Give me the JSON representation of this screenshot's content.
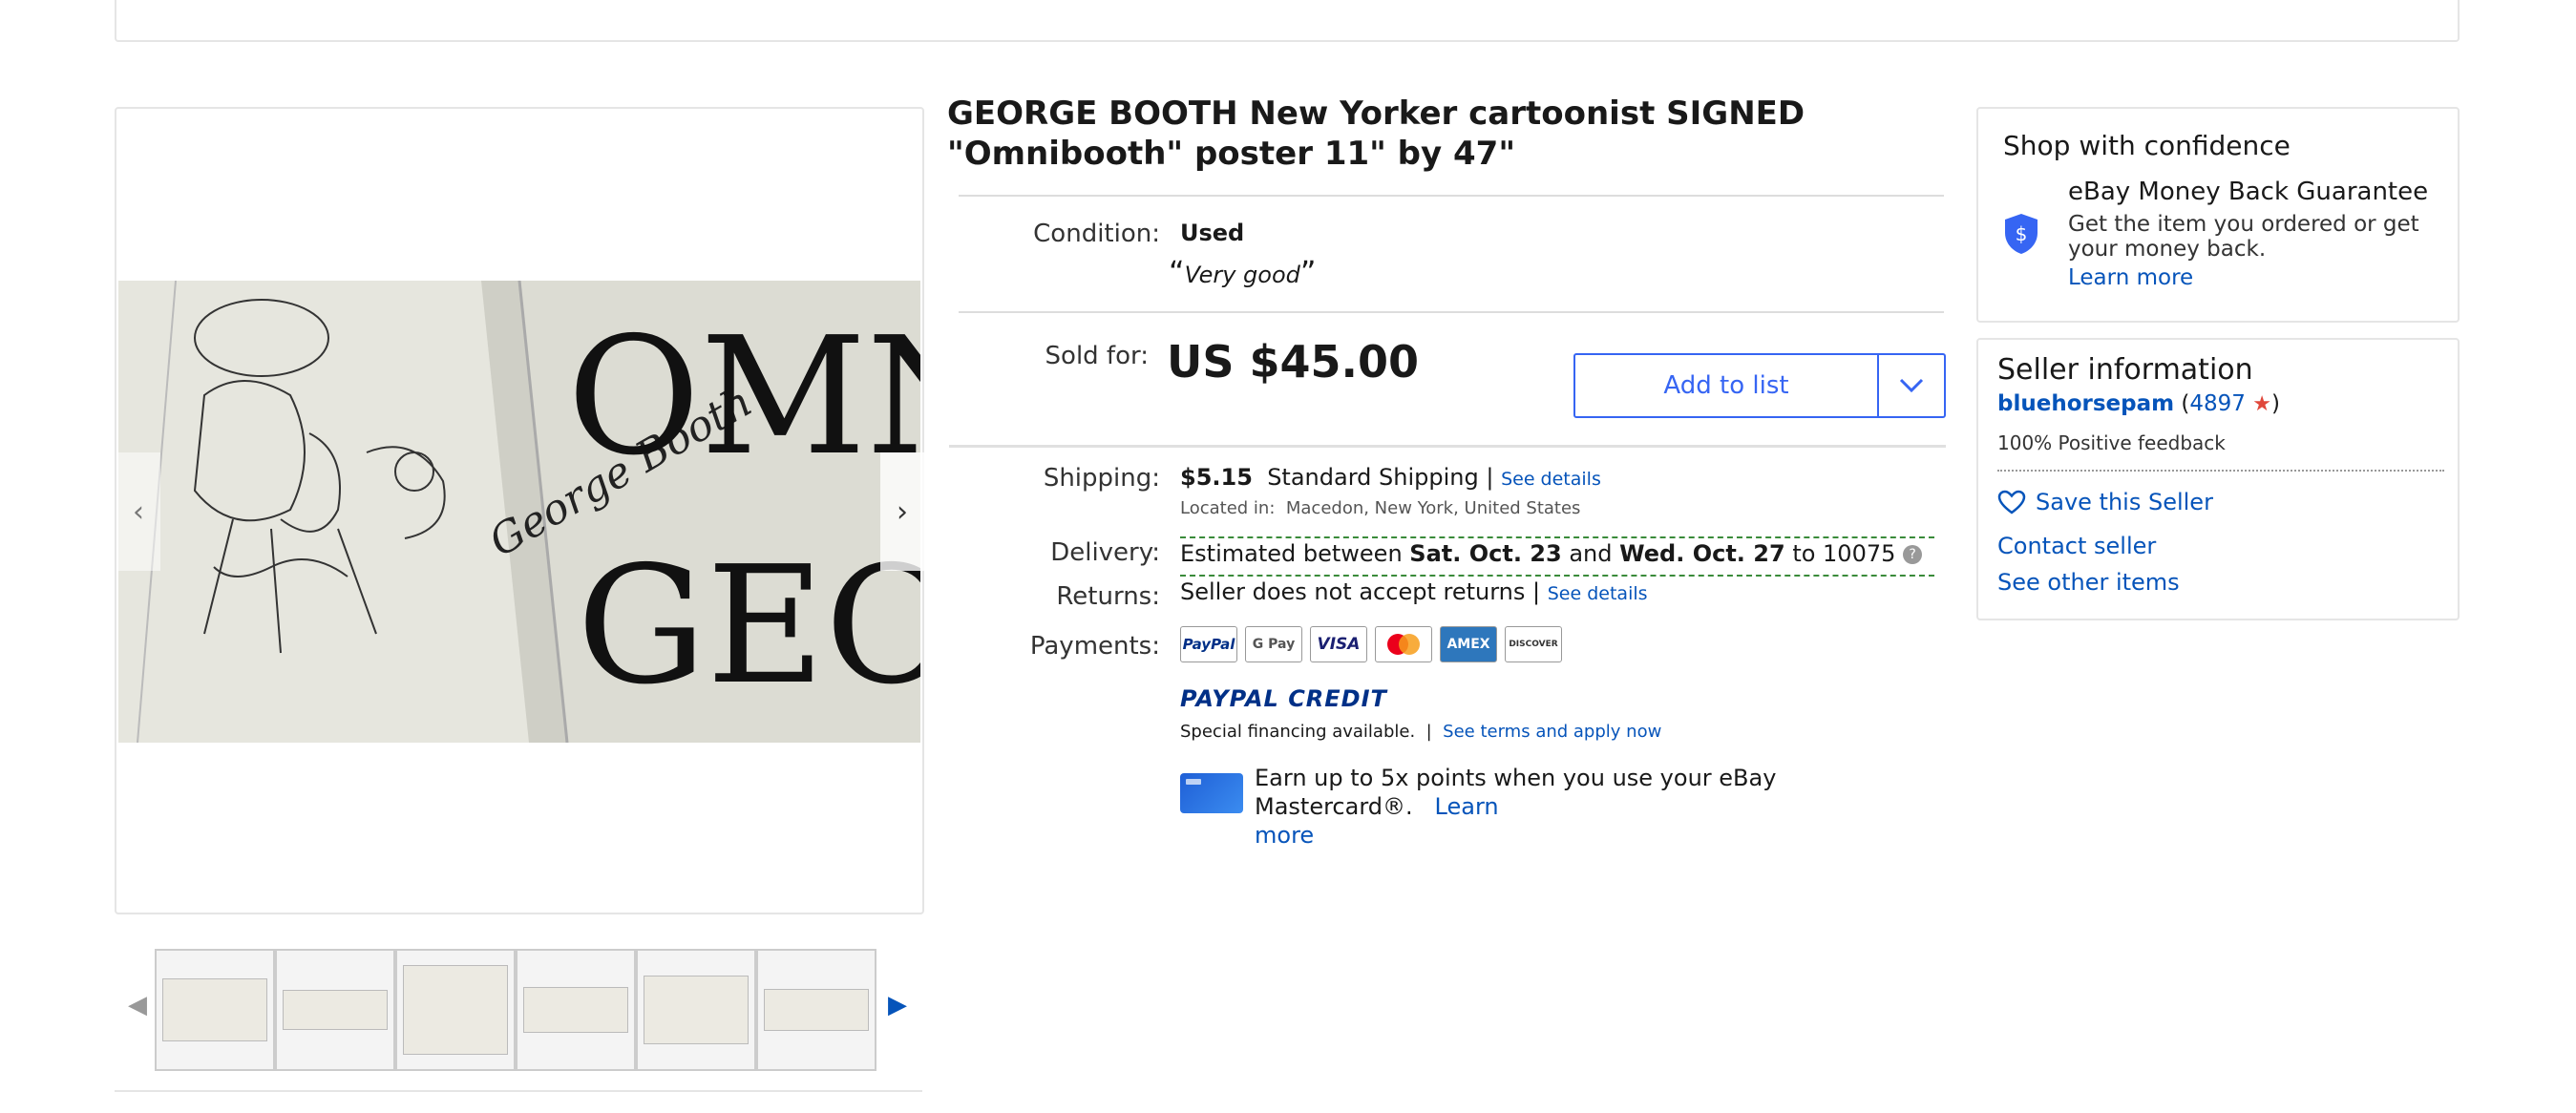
{
  "listing": {
    "title": "GEORGE BOOTH New Yorker cartoonist SIGNED \"Omnibooth\" poster 11\" by 47\"",
    "condition_label": "Condition:",
    "condition_value": "Used",
    "condition_quote": "Very good",
    "sold_for_label": "Sold for:",
    "price": "US $45.00",
    "add_to_list": "Add to list"
  },
  "shipping": {
    "label": "Shipping:",
    "cost": "$5.15",
    "method": "Standard Shipping",
    "separator": "|",
    "see_details": "See details",
    "located_label": "Located in:",
    "location": "Macedon, New York, United States"
  },
  "delivery": {
    "label": "Delivery:",
    "prefix": "Estimated between",
    "start": "Sat. Oct. 23",
    "and": "and",
    "end": "Wed. Oct. 27",
    "to": "to 10075"
  },
  "returns": {
    "label": "Returns:",
    "text": "Seller does not accept returns",
    "separator": "|",
    "see_details": "See details"
  },
  "payments": {
    "label": "Payments:",
    "methods": [
      "PayPal",
      "G Pay",
      "VISA",
      "MC",
      "AMEX",
      "DISCOVER"
    ],
    "paypal_credit": "PAYPAL CREDIT",
    "financing": "Special financing available.",
    "separator": "|",
    "financing_link": "See terms and apply now",
    "mastercard_text": "Earn up to 5x points when you use your eBay Mastercard®.",
    "learn": "Learn",
    "more": "more"
  },
  "confidence": {
    "heading": "Shop with confidence",
    "guarantee_title": "eBay Money Back Guarantee",
    "guarantee_line1": "Get the item you ordered or get",
    "guarantee_line2": "your money back.",
    "learn_more": "Learn more"
  },
  "seller": {
    "heading": "Seller information",
    "name": "bluehorsepam",
    "open_paren": "(",
    "score": "4897",
    "close_paren": ")",
    "feedback": "100% Positive feedback",
    "save": "Save this Seller",
    "contact": "Contact seller",
    "other_items": "See other items"
  },
  "gallery": {
    "image_text_top": "OMN",
    "image_text_bottom": "GEOR",
    "signature": "George Booth",
    "thumbnail_count": 6
  },
  "colors": {
    "link": "#0654ba",
    "price": "#191919",
    "delivery_dash": "#3a8b3a",
    "star": "#e0483b"
  }
}
